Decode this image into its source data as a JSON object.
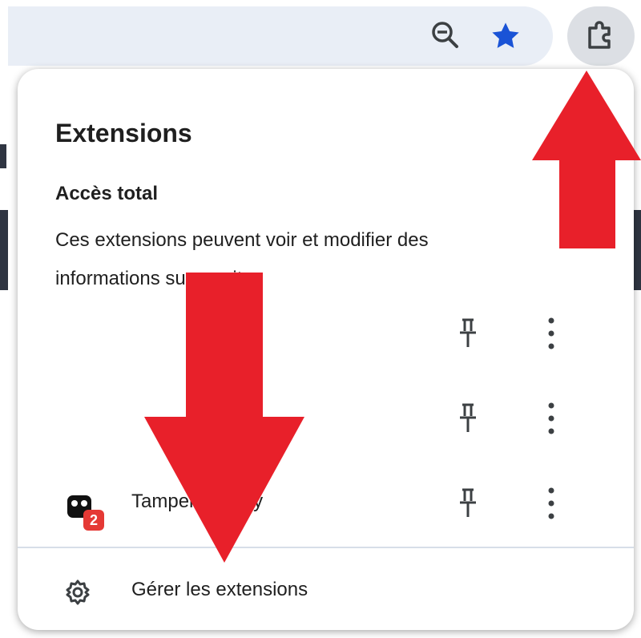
{
  "toolbar": {
    "zoom_icon": "zoom-out-icon",
    "star_icon": "bookmark-star-icon",
    "extensions_icon": "puzzle-piece-icon",
    "accent_color": "#1a53d6"
  },
  "popup": {
    "title": "Extensions",
    "section": {
      "heading": "Accès total",
      "description": "Ces extensions peuvent voir et modifier des informations sur ce site."
    },
    "extensions": [
      {
        "name": "",
        "icon": "",
        "pin_icon": "pin-icon",
        "more_icon": "more-vert-icon"
      },
      {
        "name": "",
        "icon": "",
        "pin_icon": "pin-icon",
        "more_icon": "more-vert-icon"
      },
      {
        "name": "Tampermonkey",
        "icon": "tampermonkey-icon",
        "badge": "2",
        "pin_icon": "pin-icon",
        "more_icon": "more-vert-icon"
      }
    ],
    "manage": {
      "label": "Gérer les extensions",
      "icon": "gear-icon"
    }
  },
  "annotation": {
    "arrow_color": "#e8202a"
  }
}
